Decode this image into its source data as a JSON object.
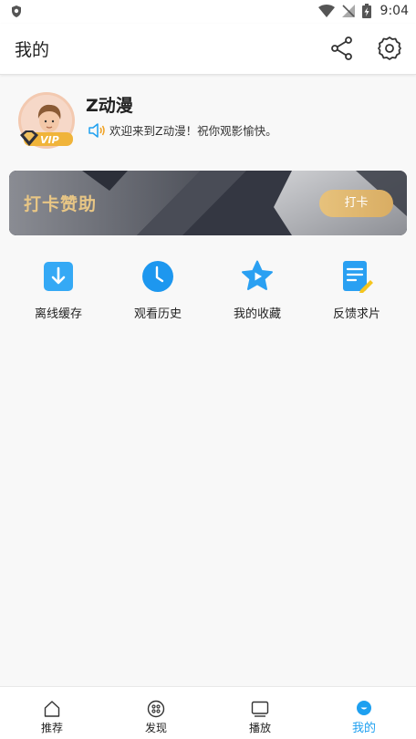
{
  "status_bar": {
    "time": "9:04"
  },
  "header": {
    "title": "我的"
  },
  "profile": {
    "username": "Z动漫",
    "welcome": "欢迎来到Z动漫！祝你观影愉快。",
    "badge": "VIP"
  },
  "banner": {
    "title": "打卡赞助",
    "button_label": "打卡"
  },
  "shortcuts": [
    {
      "label": "离线缓存",
      "icon": "download-icon"
    },
    {
      "label": "观看历史",
      "icon": "clock-icon"
    },
    {
      "label": "我的收藏",
      "icon": "star-icon"
    },
    {
      "label": "反馈求片",
      "icon": "feedback-icon"
    }
  ],
  "bottom_nav": [
    {
      "label": "推荐",
      "icon": "home-icon",
      "active": false
    },
    {
      "label": "发现",
      "icon": "discover-icon",
      "active": false
    },
    {
      "label": "播放",
      "icon": "tv-icon",
      "active": false
    },
    {
      "label": "我的",
      "icon": "profile-icon",
      "active": true
    }
  ],
  "colors": {
    "accent": "#1ea0f0",
    "gold": "#e8c685",
    "banner_dark": "#3a3d47"
  }
}
